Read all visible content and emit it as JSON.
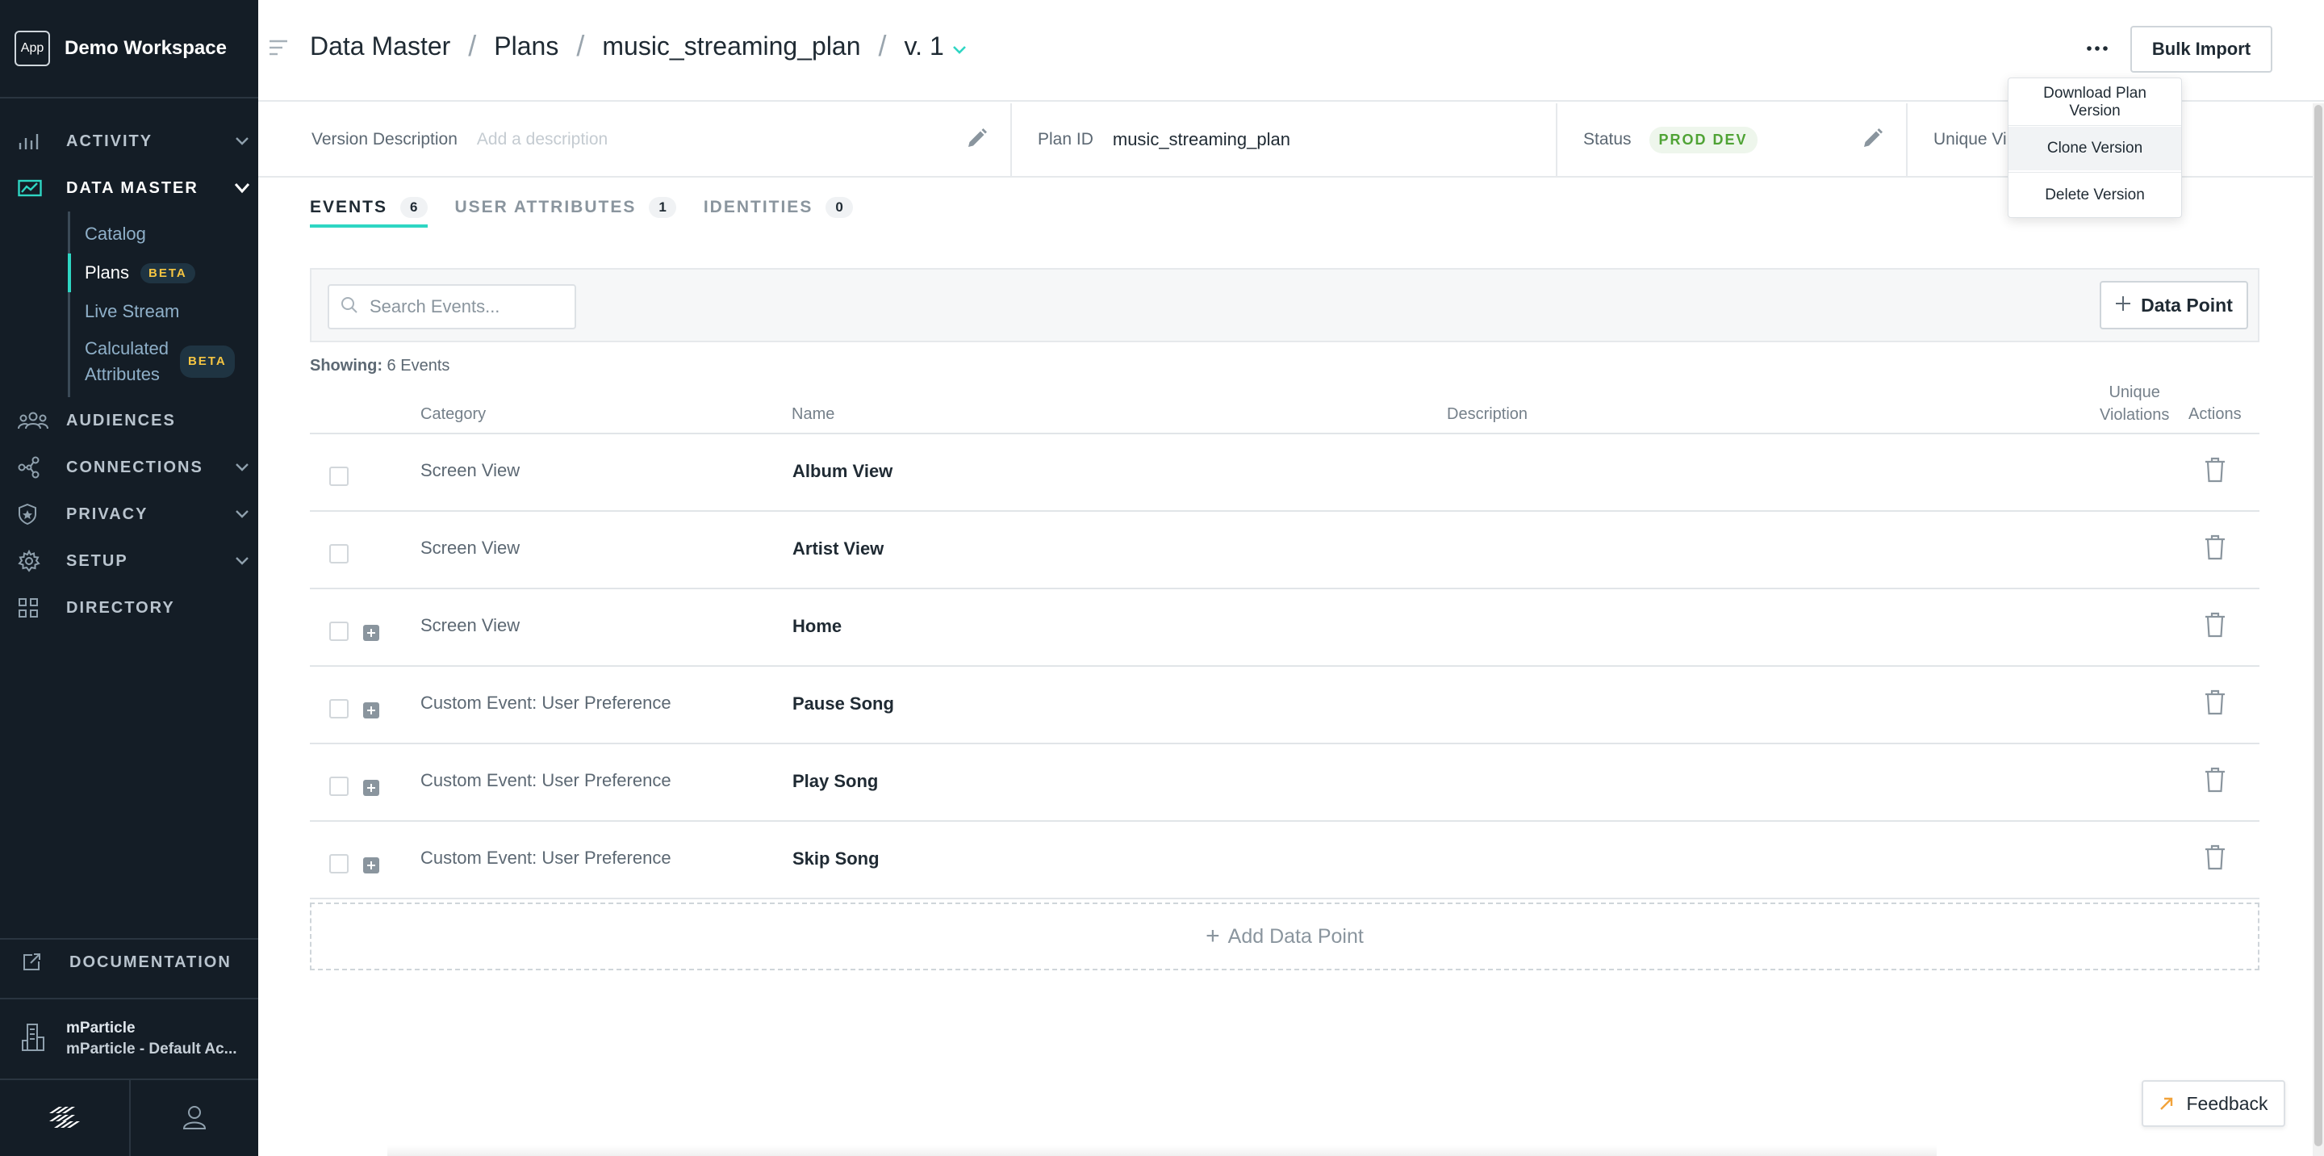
{
  "workspace": {
    "logo": "App",
    "name": "Demo Workspace"
  },
  "nav": {
    "activity": "ACTIVITY",
    "data_master": "DATA MASTER",
    "sub": {
      "catalog": "Catalog",
      "plans": "Plans",
      "plans_badge": "BETA",
      "live_stream": "Live Stream",
      "calculated_line1": "Calculated",
      "calculated_line2": "Attributes",
      "calculated_badge": "BETA"
    },
    "audiences": "AUDIENCES",
    "connections": "CONNECTIONS",
    "privacy": "PRIVACY",
    "setup": "SETUP",
    "directory": "DIRECTORY",
    "documentation": "DOCUMENTATION"
  },
  "account": {
    "org": "mParticle",
    "name": "mParticle - Default Ac..."
  },
  "breadcrumb": {
    "section": "Data Master",
    "page": "Plans",
    "plan": "music_streaming_plan",
    "version": "v. 1"
  },
  "header": {
    "bulk_import": "Bulk Import",
    "more": "..."
  },
  "menu": {
    "download_line1": "Download Plan",
    "download_line2": "Version",
    "clone": "Clone Version",
    "delete": "Delete Version"
  },
  "info": {
    "version_desc_label": "Version Description",
    "version_desc_placeholder": "Add a description",
    "plan_id_label": "Plan ID",
    "plan_id_value": "music_streaming_plan",
    "status_label": "Status",
    "status_value": "PROD DEV",
    "unique_label": "Unique Vi"
  },
  "tabs": [
    {
      "label": "EVENTS",
      "count": "6"
    },
    {
      "label": "USER ATTRIBUTES",
      "count": "1"
    },
    {
      "label": "IDENTITIES",
      "count": "0"
    }
  ],
  "search": {
    "placeholder": "Search Events..."
  },
  "data_point_button": "Data Point",
  "showing": {
    "label": "Showing:",
    "value": "6 Events"
  },
  "table": {
    "headers": {
      "category": "Category",
      "name": "Name",
      "description": "Description",
      "unique_line1": "Unique",
      "unique_line2": "Violations",
      "actions": "Actions"
    },
    "rows": [
      {
        "category": "Screen View",
        "name": "Album View"
      },
      {
        "category": "Screen View",
        "name": "Artist View"
      },
      {
        "category": "Screen View",
        "name": "Home"
      },
      {
        "category": "Custom Event: User Preference",
        "name": "Pause Song"
      },
      {
        "category": "Custom Event: User Preference",
        "name": "Play Song"
      },
      {
        "category": "Custom Event: User Preference",
        "name": "Skip Song"
      }
    ]
  },
  "add_data_point": "Add Data Point",
  "feedback": "Feedback",
  "colors": {
    "sidebar": "#141d26",
    "accent": "#2ed6c3",
    "beta": "#f5c542",
    "status": "#4fa335"
  }
}
